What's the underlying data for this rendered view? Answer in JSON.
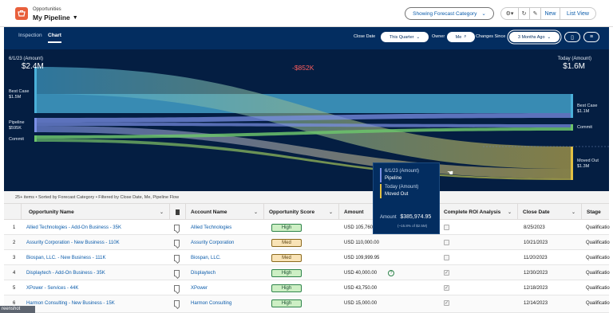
{
  "header": {
    "object_label": "Opportunities",
    "view_title": "My Pipeline",
    "forecast_button": "Showing Forecast Category",
    "new_button": "New",
    "list_view_button": "List View"
  },
  "toolbar": {
    "tabs": [
      "Inspection",
      "Chart"
    ],
    "active_tab": "Chart",
    "close_date_label": "Close Date",
    "close_date_value": "This Quarter",
    "owner_label": "Owner",
    "owner_value": "Me",
    "changes_since_label": "Changes Since",
    "changes_since_value": "3 Months Ago"
  },
  "chart_data": {
    "type": "sankey",
    "left_date_label": "6/1/23 (Amount)",
    "left_total": "$2.4M",
    "right_date_label": "Today (Amount)",
    "right_total": "$1.6M",
    "delta": "-$852K",
    "left_nodes": [
      {
        "name": "Best Case",
        "amount": "$1.5M",
        "color": "#4ab0d9"
      },
      {
        "name": "Pipeline",
        "amount": "$595K",
        "color": "#7a8fe6"
      },
      {
        "name": "Commit",
        "amount": "",
        "color": "#6cc36b"
      }
    ],
    "right_nodes": [
      {
        "name": "Best Case",
        "amount": "$1.1M",
        "color": "#4ab0d9"
      },
      {
        "name": "Commit",
        "amount": "",
        "color": "#6cc36b"
      },
      {
        "name": "Moved Out",
        "amount": "$1.3M",
        "color": "#e2c043"
      }
    ],
    "tooltip": {
      "from_label": "6/1/23 (Amount)",
      "from_value": "Pipeline",
      "to_label": "Today (Amount)",
      "to_value": "Moved Out",
      "amount_label": "Amount",
      "amount_value": "$385,974.95",
      "amount_note": "(~15.8% of $2.5M)"
    }
  },
  "table": {
    "status": "25+ items • Sorted by Forecast Category • Filtered by Close Date, Me, Pipeline Flow",
    "columns": [
      "Opportunity Name",
      "Account Name",
      "Opportunity Score",
      "Amount",
      "Complete ROI Analysis",
      "Close Date",
      "Stage"
    ],
    "rows": [
      {
        "num": "1",
        "opportunity": "Allied Technologies - Add-On Business - 35K",
        "account": "Allied Technologies",
        "score": "High",
        "amount": "USD 105,760.",
        "roi": false,
        "close_date": "8/25/2023",
        "stage": "Qualification"
      },
      {
        "num": "2",
        "opportunity": "Assurity Corporation - New Business - 110K",
        "account": "Assurity Corporation",
        "score": "Med",
        "amount": "USD 110,000.00",
        "roi": false,
        "close_date": "10/21/2023",
        "stage": "Qualification"
      },
      {
        "num": "3",
        "opportunity": "Biospan, LLC. - New Business - 111K",
        "account": "Biospan, LLC.",
        "score": "Med",
        "amount": "USD 109,999.95",
        "roi": false,
        "close_date": "11/20/2023",
        "stage": "Qualification"
      },
      {
        "num": "4",
        "opportunity": "Displaytech - Add-On Business - 35K",
        "account": "Displaytech",
        "score": "High",
        "amount": "USD 40,000.00",
        "roi": true,
        "close_date": "12/30/2023",
        "stage": "Qualification"
      },
      {
        "num": "5",
        "opportunity": "XPower - Services - 44K",
        "account": "XPower",
        "score": "High",
        "amount": "USD 43,750.00",
        "roi": true,
        "close_date": "12/18/2023",
        "stage": "Qualification"
      },
      {
        "num": "6",
        "opportunity": "Harmon Consulting - New Business - 15K",
        "account": "Harmon Consulting",
        "score": "High",
        "amount": "USD 15,000.00",
        "roi": true,
        "close_date": "12/14/2023",
        "stage": "Qualification"
      }
    ]
  },
  "overlay": {
    "corner_text": "reenshot"
  }
}
